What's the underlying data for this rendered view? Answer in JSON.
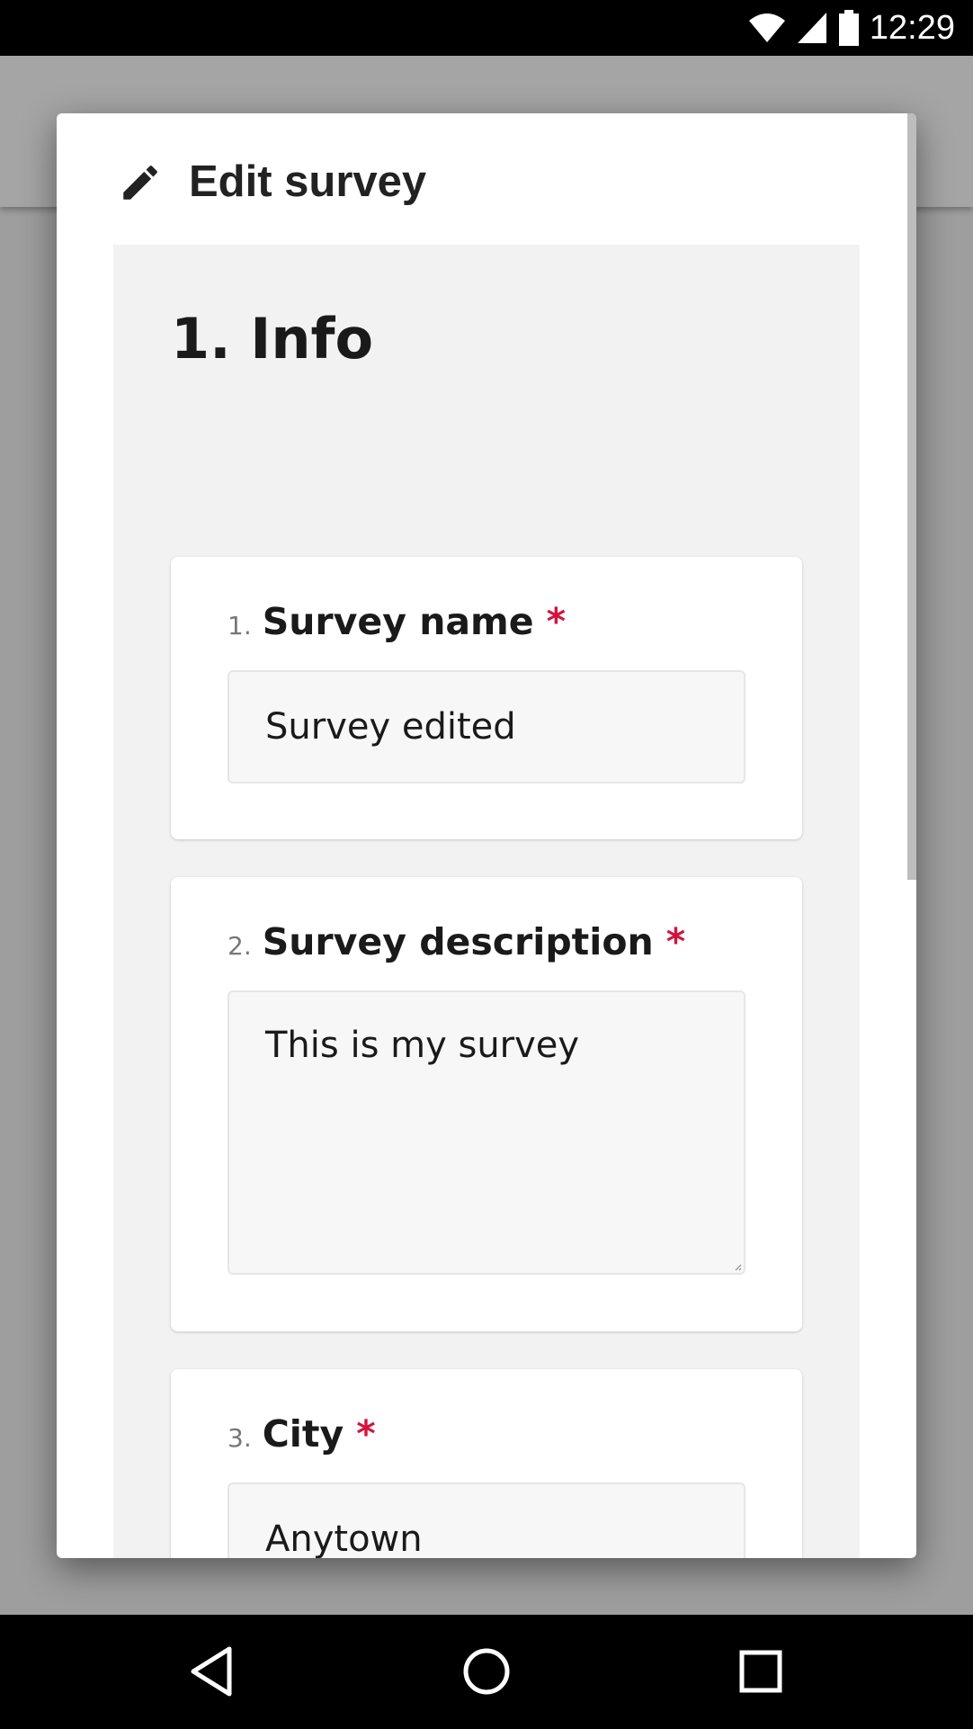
{
  "status_bar": {
    "time": "12:29"
  },
  "dialog": {
    "title": "Edit survey",
    "title_icon": "pencil-icon"
  },
  "section": {
    "title": "1. Info"
  },
  "questions": [
    {
      "number": "1.",
      "label": "Survey name",
      "required_mark": "*",
      "value": "Survey edited"
    },
    {
      "number": "2.",
      "label": "Survey description",
      "required_mark": "*",
      "value": "This is my survey"
    },
    {
      "number": "3.",
      "label": "City",
      "required_mark": "*",
      "value": "Anytown"
    }
  ],
  "colors": {
    "required": "#d3133b",
    "section_bg": "#f2f2f2",
    "field_bg": "#f7f7f7"
  },
  "nav_bar": {
    "icons": [
      "back-icon",
      "home-icon",
      "recents-icon"
    ]
  }
}
